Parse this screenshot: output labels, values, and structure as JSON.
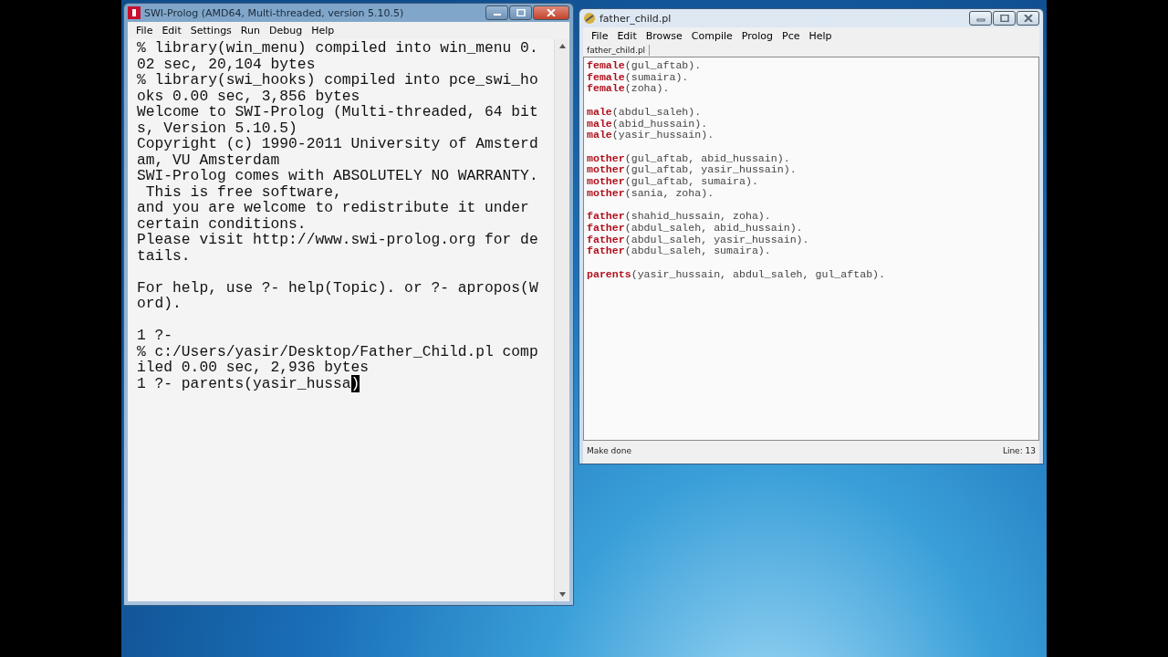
{
  "console_window": {
    "title": "SWI-Prolog (AMD64, Multi-threaded, version 5.10.5)",
    "menu": [
      "File",
      "Edit",
      "Settings",
      "Run",
      "Debug",
      "Help"
    ],
    "blocks": [
      [
        "% library(win_menu) compiled into win_menu 0.",
        "02 sec, 20,104 bytes",
        "% library(swi_hooks) compiled into pce_swi_ho",
        "oks 0.00 sec, 3,856 bytes",
        "Welcome to SWI-Prolog (Multi-threaded, 64 bit",
        "s, Version 5.10.5)",
        "Copyright (c) 1990-2011 University of Amsterd",
        "am, VU Amsterdam",
        "SWI-Prolog comes with ABSOLUTELY NO WARRANTY.",
        " This is free software,",
        "and you are welcome to redistribute it under",
        "certain conditions.",
        "Please visit http://www.swi-prolog.org for de",
        "tails."
      ],
      [
        "For help, use ?- help(Topic). or ?- apropos(W",
        "ord)."
      ],
      [
        "1 ?-",
        "% c:/Users/yasir/Desktop/Father_Child.pl comp",
        "iled 0.00 sec, 2,936 bytes"
      ]
    ],
    "input_line": {
      "text": "1 ?- parents(yasir_hussa",
      "cursor_char": ")"
    }
  },
  "editor_window": {
    "title": "father_child.pl",
    "menu": [
      "File",
      "Edit",
      "Browse",
      "Compile",
      "Prolog",
      "Pce",
      "Help"
    ],
    "tab": "father_child.pl",
    "groups": [
      [
        {
          "functor": "female",
          "args": "(gul_aftab)."
        },
        {
          "functor": "female",
          "args": "(sumaira)."
        },
        {
          "functor": "female",
          "args": "(zoha)."
        }
      ],
      [
        {
          "functor": "male",
          "args": "(abdul_saleh)."
        },
        {
          "functor": "male",
          "args": "(abid_hussain)."
        },
        {
          "functor": "male",
          "args": "(yasir_hussain)."
        }
      ],
      [
        {
          "functor": "mother",
          "args": "(gul_aftab, abid_hussain)."
        },
        {
          "functor": "mother",
          "args": "(gul_aftab, yasir_hussain)."
        },
        {
          "functor": "mother",
          "args": "(gul_aftab, sumaira)."
        },
        {
          "functor": "mother",
          "args": "(sania, zoha)."
        }
      ],
      [
        {
          "functor": "father",
          "args": "(shahid_hussain, zoha)."
        },
        {
          "functor": "father",
          "args": "(abdul_saleh, abid_hussain)."
        },
        {
          "functor": "father",
          "args": "(abdul_saleh, yasir_hussain)."
        },
        {
          "functor": "father",
          "args": "(abdul_saleh, sumaira)."
        }
      ],
      [
        {
          "functor": "parents",
          "args": "(yasir_hussain, abdul_saleh, gul_aftab)."
        }
      ]
    ],
    "status": "Make done",
    "line_indicator": "Line: 13"
  }
}
